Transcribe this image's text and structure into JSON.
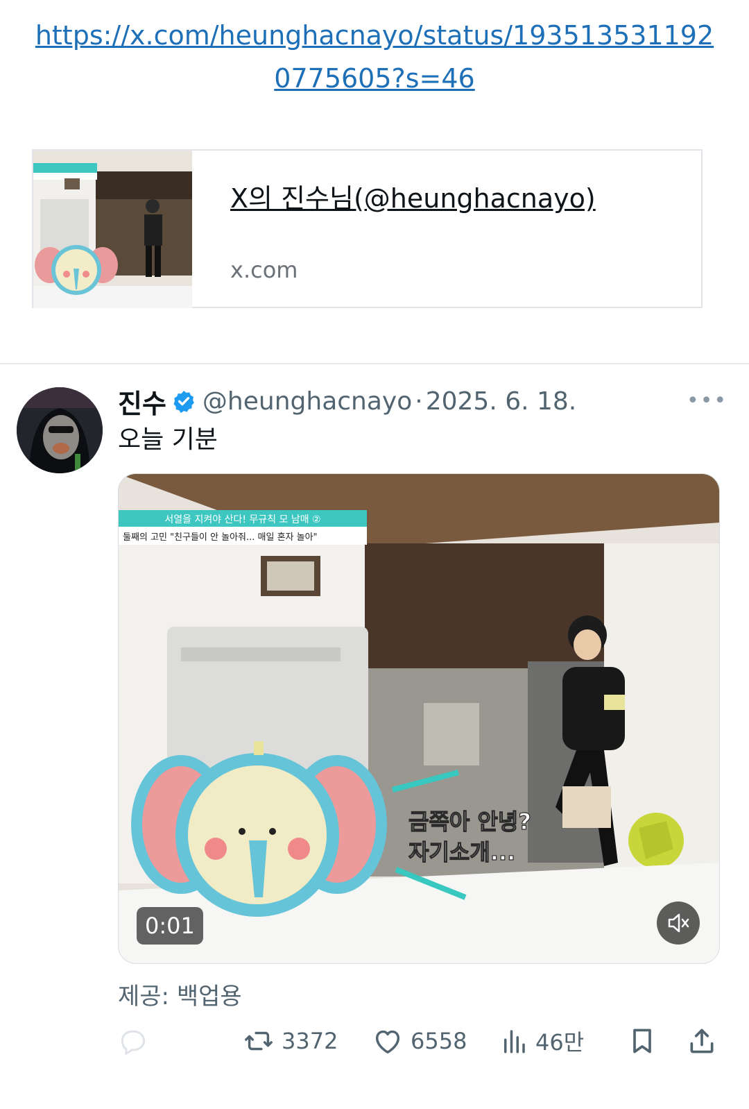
{
  "link": {
    "url": "https://x.com/heunghacnayo/status/1935135311920775605?s=46"
  },
  "link_card": {
    "title": "X의 진수님(@heunghacnayo)",
    "domain": "x.com"
  },
  "tweet": {
    "display_name": "진수",
    "handle": "@heunghacnayo",
    "separator": "·",
    "date": "2025. 6. 18.",
    "text": "오늘 기분",
    "media": {
      "duration": "0:01",
      "overlay_banner_top": "서열을 지켜야 산다! 무규칙 모 남매 ②",
      "overlay_banner_bottom": "둘째의 고민 \"친구들이 안 놀아줘... 매일 혼자 놀아\"",
      "subtitle_line1": "금쪽아 안녕?",
      "subtitle_line2": "자기소개..."
    },
    "attribution": "제공: 백업용",
    "actions": {
      "retweets": "3372",
      "likes": "6558",
      "views": "46만"
    }
  },
  "colors": {
    "link": "#1d6fb8",
    "verified": "#1d9bf0",
    "muted_text": "#536471"
  },
  "icons": [
    "verified-badge-icon",
    "more-icon",
    "mute-icon",
    "reply-icon",
    "retweet-icon",
    "like-icon",
    "views-icon",
    "bookmark-icon",
    "share-icon"
  ]
}
